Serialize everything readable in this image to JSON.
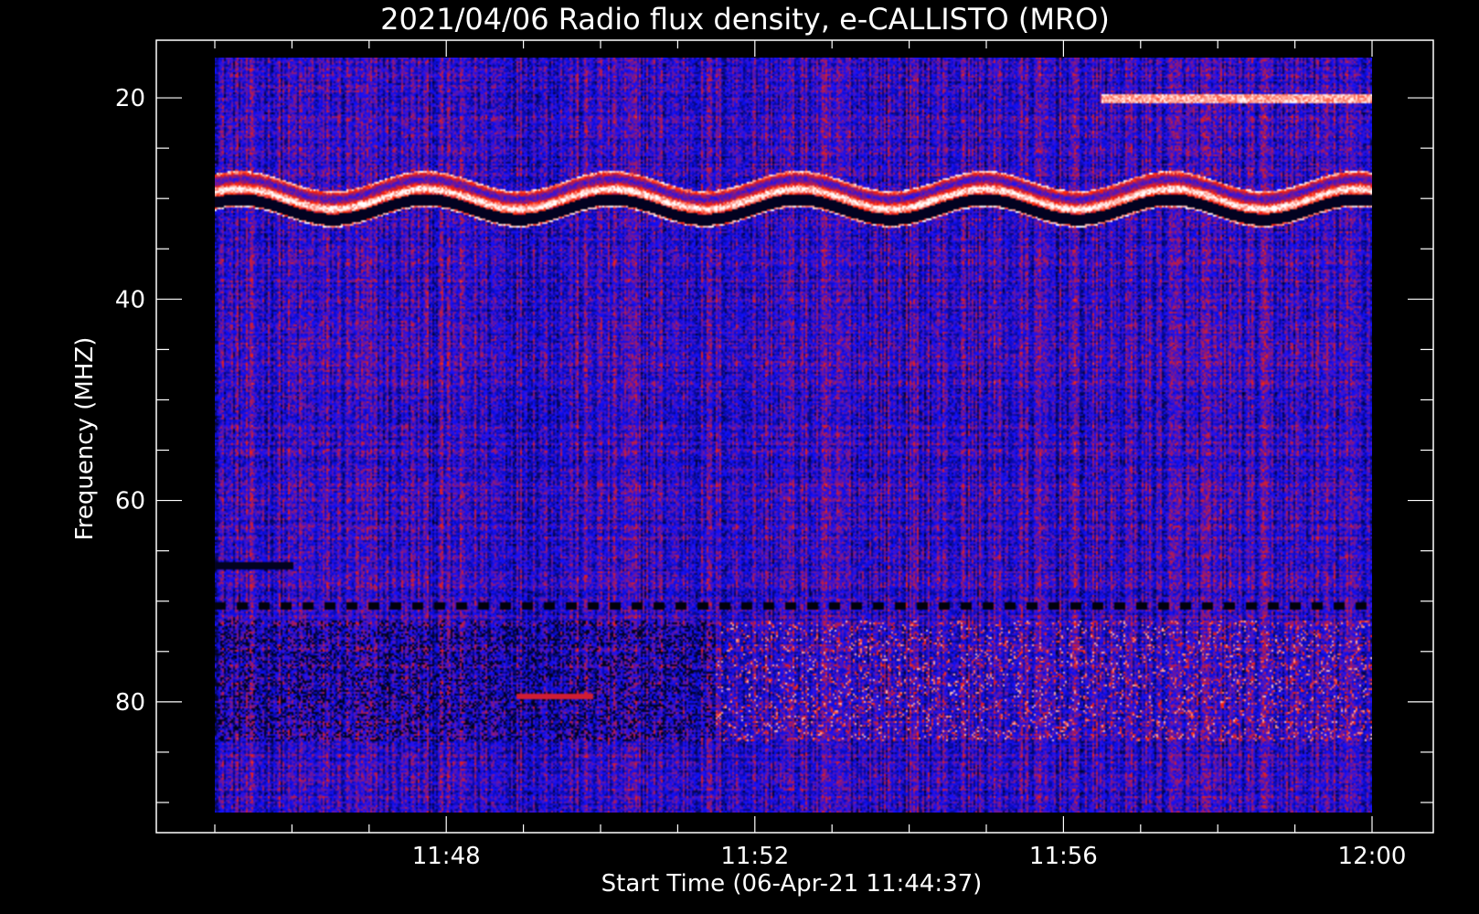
{
  "chart_data": {
    "type": "heatmap",
    "title": "2021/04/06  Radio flux density, e-CALLISTO (MRO)",
    "xlabel": "Start Time (06-Apr-21 11:44:37)",
    "ylabel": "Frequency (MHZ)",
    "x_ticks": [
      "11:48",
      "11:52",
      "11:56",
      "12:00"
    ],
    "x_tick_minutes": [
      48,
      52,
      56,
      60
    ],
    "y_ticks": [
      "20",
      "40",
      "60",
      "80"
    ],
    "y_tick_values": [
      20,
      40,
      60,
      80
    ],
    "xlim_minutes": [
      45,
      60
    ],
    "ylim": [
      91,
      16
    ],
    "y_inverted": true,
    "colormap": {
      "low": "#000000",
      "mid": "#1010ff",
      "high": "#ff2000",
      "peak": "#ffffff"
    },
    "features": [
      {
        "name": "band-20",
        "freq": 20,
        "t_start": 56.5,
        "t_end": 60,
        "intensity": 0.9
      },
      {
        "name": "wavy-band-30",
        "freq": 30,
        "t_start": 45,
        "t_end": 60,
        "intensity": 1.0
      },
      {
        "name": "burst-region-72",
        "freq_min": 72,
        "freq_max": 84,
        "t_start": 51.5,
        "t_end": 60,
        "intensity": 0.7
      },
      {
        "name": "line-79",
        "freq": 79.5,
        "t_start": 48.9,
        "t_end": 49.9,
        "intensity": 0.7
      }
    ]
  }
}
